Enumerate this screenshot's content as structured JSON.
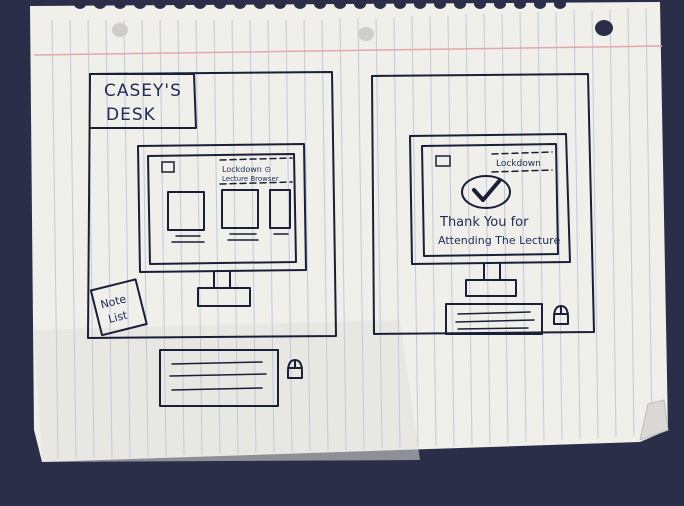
{
  "left_sketch": {
    "title_line1": "CASEY'S",
    "title_line2": "DESK",
    "header_line1": "Lockdown ⊙",
    "header_line2": "Lecture Browser",
    "note_line1": "Note",
    "note_line2": "List"
  },
  "right_sketch": {
    "header": "Lockdown",
    "message_line1": "Thank You for",
    "message_line2": "Attending The Lecture"
  },
  "colors": {
    "background": "#2b2f4a",
    "paper": "#f3f1ec",
    "rule_line": "#a9c3dd",
    "margin_line": "#e2a3a8",
    "ink": "#1a1f38"
  }
}
